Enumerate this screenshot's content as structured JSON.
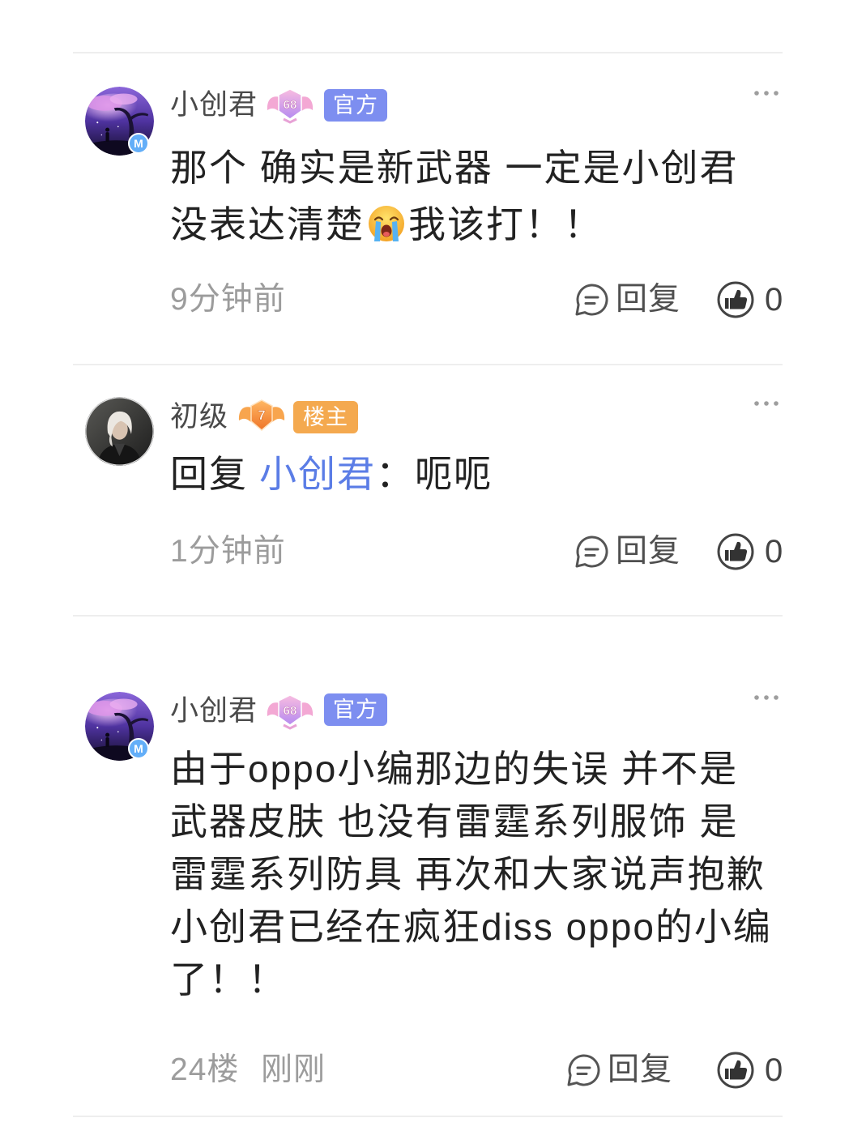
{
  "theme": {
    "official_tag_color": "#7d8ef0",
    "owner_tag_color": "#f4a94f",
    "mention_color": "#5b7de6",
    "meta_color": "#9c9c9c",
    "text_color": "#222222"
  },
  "comments": [
    {
      "username": "小创君",
      "level": "68",
      "level_badge": "purple-winged-level-badge",
      "tag": "官方",
      "avatar": "night-tree-scene-avatar",
      "avatar_mark": "M",
      "lines": [
        {
          "text": "那个 确实是新武器 一定是小创君"
        },
        {
          "text": "没表达清楚",
          "emoji": "crying-face-emoji",
          "after": "我该打！！"
        }
      ],
      "time": "9分钟前",
      "reply_label": "回复",
      "like_count": "0"
    },
    {
      "username": "初级",
      "level": "7",
      "level_badge": "orange-winged-level-badge",
      "tag": "楼主",
      "avatar": "silver-hair-portrait-avatar",
      "reply": {
        "prefix": "回复",
        "mention": "小创君",
        "text": "：呃呃"
      },
      "time": "1分钟前",
      "reply_label": "回复",
      "like_count": "0"
    },
    {
      "username": "小创君",
      "level": "68",
      "level_badge": "purple-winged-level-badge",
      "tag": "官方",
      "avatar": "night-tree-scene-avatar",
      "avatar_mark": "M",
      "lines": [
        {
          "text": "由于oppo小编那边的失误 并不是"
        },
        {
          "text": "武器皮肤 也没有雷霆系列服饰 是"
        },
        {
          "text": "雷霆系列防具 再次和大家说声抱歉"
        },
        {
          "text": "小创君已经在疯狂diss oppo的小编"
        },
        {
          "text": "了！！"
        }
      ],
      "floor": "24楼",
      "time": "刚刚",
      "reply_label": "回复",
      "like_count": "0"
    }
  ]
}
